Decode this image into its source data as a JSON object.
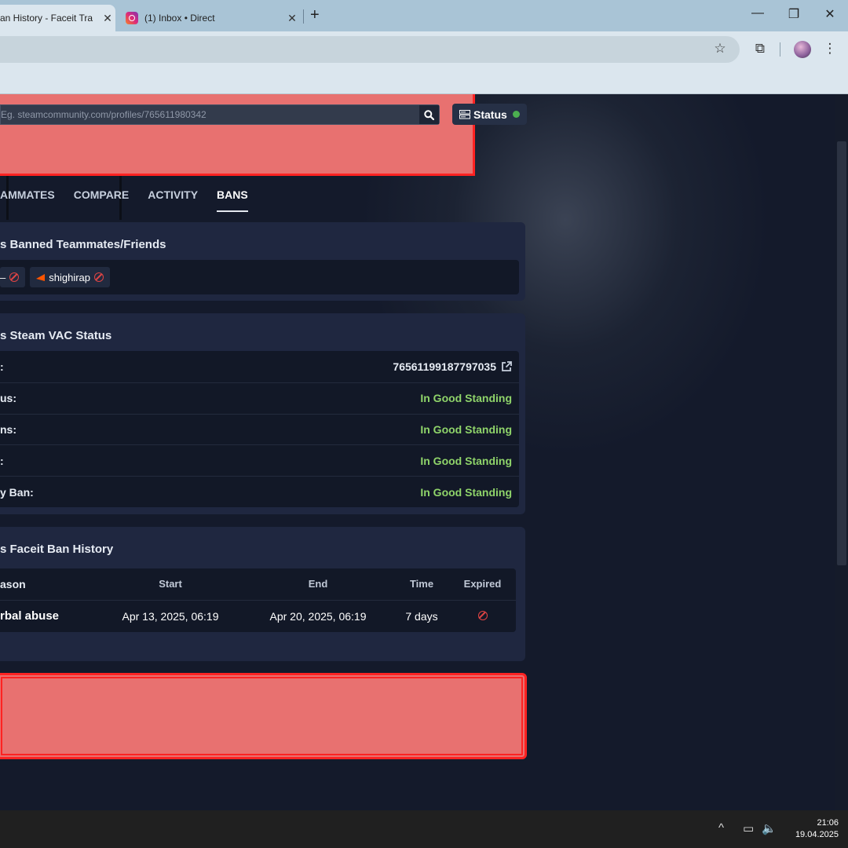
{
  "browser": {
    "tabs": [
      {
        "label": "an History - Faceit Tra",
        "close": "✕"
      },
      {
        "label": "(1) Inbox • Direct",
        "close": "✕"
      }
    ],
    "new_tab": "+",
    "window": {
      "minimize": "—",
      "maximize": "❐",
      "close": "✕"
    },
    "toolbar": {
      "bookmark_icon": "☆",
      "extensions_icon": "⧉",
      "menu_icon": "⋮"
    }
  },
  "header": {
    "search_placeholder": "Eg. steamcommunity.com/profiles/765611980342",
    "status_label": "Status"
  },
  "nav": {
    "tabs": [
      "AMMATES",
      "COMPARE",
      "ACTIVITY",
      "BANS"
    ],
    "active": "BANS"
  },
  "banned_friends": {
    "title": "s Banned Teammates/Friends",
    "chips": [
      {
        "name": "–"
      },
      {
        "name": "shighirap"
      }
    ]
  },
  "vac": {
    "title": "s Steam VAC Status",
    "rows": [
      {
        "label": ":",
        "value": "76561199187797035"
      },
      {
        "label": "us:",
        "value": "In Good Standing"
      },
      {
        "label": "ns:",
        "value": "In Good Standing"
      },
      {
        "label": ":",
        "value": "In Good Standing"
      },
      {
        "label": "y Ban:",
        "value": "In Good Standing"
      }
    ]
  },
  "faceit_bans": {
    "title": "s Faceit Ban History",
    "columns": [
      "ason",
      "Start",
      "End",
      "Time",
      "Expired"
    ],
    "rows": [
      {
        "reason": "rbal abuse",
        "start": "Apr 13, 2025, 06:19",
        "end": "Apr 20, 2025, 06:19",
        "time": "7 days"
      }
    ]
  },
  "taskbar": {
    "time": "21:06",
    "date": "19.04.2025",
    "tray_up": "^",
    "network_icon": "▭",
    "volume_icon": "🔈"
  },
  "colors": {
    "good": "#8fd46a",
    "ban": "#e04444",
    "redact": "#e87170"
  }
}
